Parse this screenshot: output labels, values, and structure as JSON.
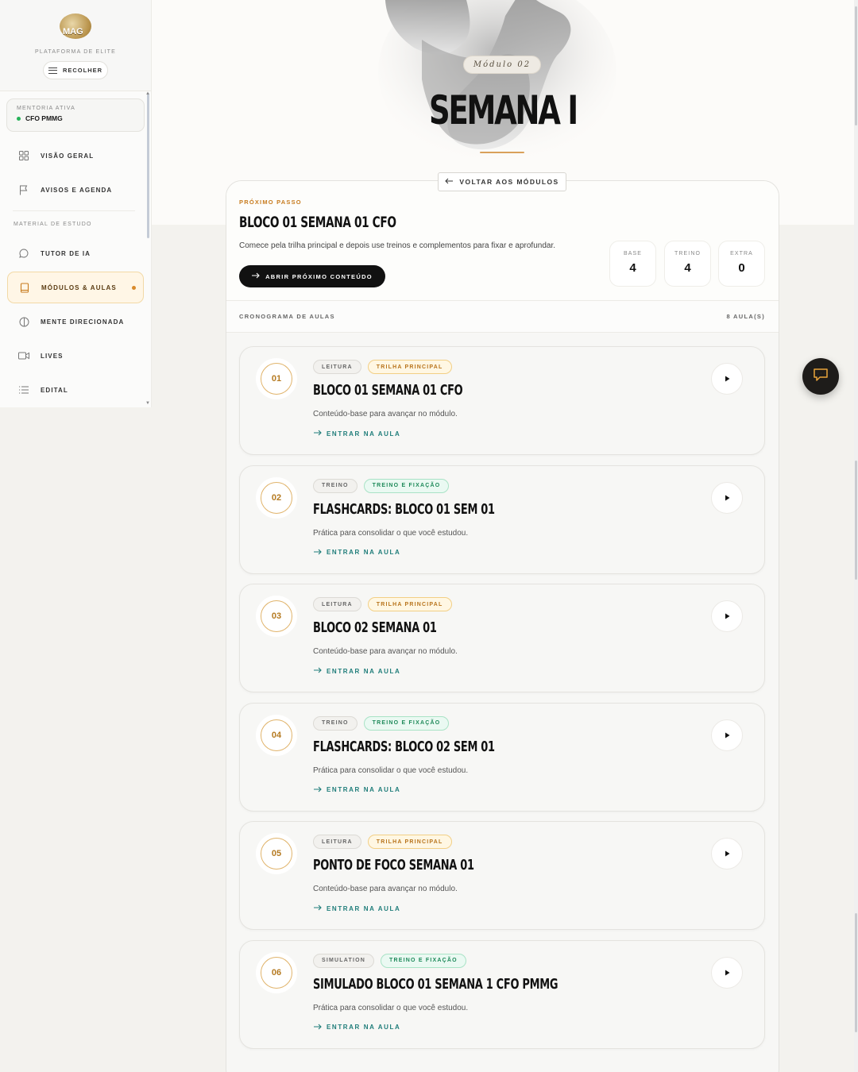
{
  "sidebar": {
    "brand_logo_text": "MAG",
    "brand_subtitle": "PLATAFORMA DE ELITE",
    "collapse_label": "RECOLHER",
    "mentoria_label": "MENTORIA ATIVA",
    "mentoria_value": "CFO PMMG",
    "items_top": [
      {
        "label": "VISÃO GERAL",
        "icon": "grid-icon"
      },
      {
        "label": "AVISOS E AGENDA",
        "icon": "flag-icon"
      }
    ],
    "section_label": "MATERIAL DE ESTUDO",
    "items_study": [
      {
        "label": "TUTOR DE IA",
        "icon": "chat-bubble-icon"
      },
      {
        "label": "MÓDULOS & AULAS",
        "icon": "book-icon",
        "active": true
      },
      {
        "label": "MENTE DIRECIONADA",
        "icon": "brain-icon"
      },
      {
        "label": "LIVES",
        "icon": "video-icon"
      },
      {
        "label": "EDITAL",
        "icon": "list-icon"
      }
    ]
  },
  "hero": {
    "module_label": "Módulo 02",
    "title": "SEMANA I"
  },
  "back_button_label": "VOLTAR AOS MÓDULOS",
  "next_step": {
    "kicker": "PRÓXIMO PASSO",
    "title": "BLOCO 01 SEMANA 01 CFO",
    "description": "Comece pela trilha principal e depois use treinos e complementos para fixar e aprofundar.",
    "button_label": "ABRIR PRÓXIMO CONTEÚDO",
    "stats": [
      {
        "label": "BASE",
        "value": "4"
      },
      {
        "label": "TREINO",
        "value": "4"
      },
      {
        "label": "EXTRA",
        "value": "0"
      }
    ]
  },
  "schedule": {
    "label": "CRONOGRAMA DE AULAS",
    "count": "8 AULA(S)"
  },
  "lessons": [
    {
      "number": "01",
      "type": "LEITURA",
      "track": "TRILHA PRINCIPAL",
      "track_kind": "main",
      "title": "BLOCO 01 SEMANA 01 CFO",
      "description": "Conteúdo-base para avançar no módulo.",
      "link": "ENTRAR NA AULA"
    },
    {
      "number": "02",
      "type": "TREINO",
      "track": "TREINO E FIXAÇÃO",
      "track_kind": "train",
      "title": "FLASHCARDS: BLOCO 01 SEM 01",
      "description": "Prática para consolidar o que você estudou.",
      "link": "ENTRAR NA AULA"
    },
    {
      "number": "03",
      "type": "LEITURA",
      "track": "TRILHA PRINCIPAL",
      "track_kind": "main",
      "title": "BLOCO 02 SEMANA 01",
      "description": "Conteúdo-base para avançar no módulo.",
      "link": "ENTRAR NA AULA"
    },
    {
      "number": "04",
      "type": "TREINO",
      "track": "TREINO E FIXAÇÃO",
      "track_kind": "train",
      "title": "FLASHCARDS: BLOCO 02 SEM 01",
      "description": "Prática para consolidar o que você estudou.",
      "link": "ENTRAR NA AULA"
    },
    {
      "number": "05",
      "type": "LEITURA",
      "track": "TRILHA PRINCIPAL",
      "track_kind": "main",
      "title": "PONTO DE FOCO SEMANA 01",
      "description": "Conteúdo-base para avançar no módulo.",
      "link": "ENTRAR NA AULA"
    },
    {
      "number": "06",
      "type": "SIMULATION",
      "track": "TREINO E FIXAÇÃO",
      "track_kind": "train",
      "title": "SIMULADO BLOCO 01 SEMANA 1 CFO PMMG",
      "description": "Prática para consolidar o que você estudou.",
      "link": "ENTRAR NA AULA"
    }
  ],
  "colors": {
    "accent_gold": "#c77b1e",
    "teal_link": "#1f7d7a",
    "active_green": "#27b35a",
    "dark": "#111111"
  }
}
